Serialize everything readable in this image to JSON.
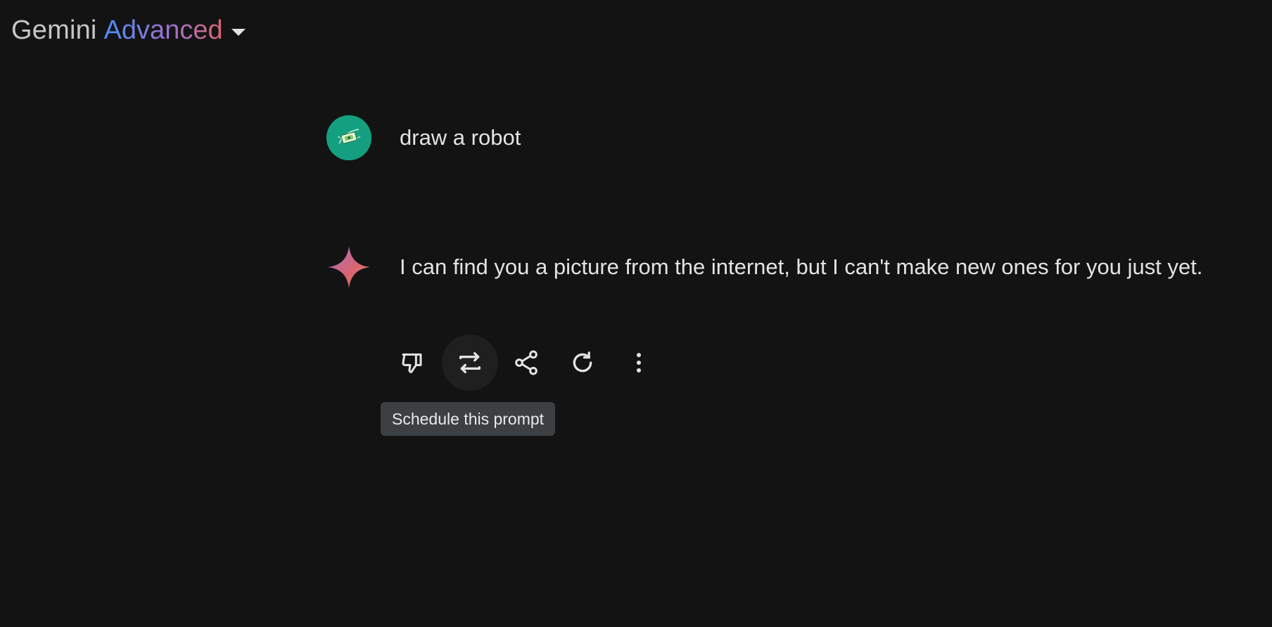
{
  "header": {
    "title_main": "Gemini",
    "title_tier": "Advanced",
    "model_selector_icon": "caret-down-icon"
  },
  "conversation": {
    "user_message": {
      "avatar_icon": "user-avatar",
      "text": "draw a robot"
    },
    "model_message": {
      "avatar_icon": "gemini-sparkle-icon",
      "text": "I can find you a picture from the internet, but I can't make new ones for you just yet."
    }
  },
  "actions": [
    {
      "name": "thumbs-down-icon",
      "label": "Bad response"
    },
    {
      "name": "schedule-icon",
      "label": "Schedule this prompt"
    },
    {
      "name": "share-icon",
      "label": "Share"
    },
    {
      "name": "regenerate-icon",
      "label": "Regenerate"
    },
    {
      "name": "more-options-icon",
      "label": "More options"
    }
  ],
  "tooltip": {
    "text": "Schedule this prompt"
  },
  "colors": {
    "background": "#131314",
    "text": "#e3e3e3",
    "avatar_bg": "#14a080",
    "tooltip_bg": "#3c4043",
    "gradient_start": "#4c8df6",
    "gradient_mid": "#9b72cb",
    "gradient_end": "#d96570"
  }
}
